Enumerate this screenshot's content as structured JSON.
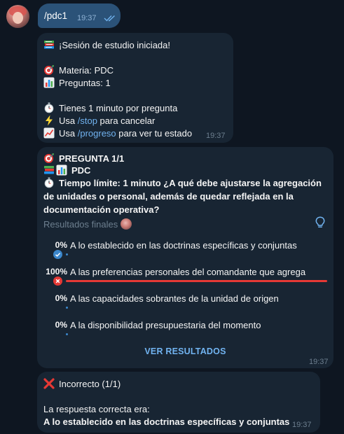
{
  "outgoing": {
    "command": "/pdc1",
    "time": "19:37"
  },
  "session_msg": {
    "title": "¡Sesión de estudio iniciada!",
    "subject": "Materia: PDC",
    "questions": "Preguntas: 1",
    "time_per_question": "Tienes 1 minuto por pregunta",
    "stop_pre": "Usa ",
    "stop_cmd": "/stop",
    "stop_post": " para cancelar",
    "progress_pre": "Usa ",
    "progress_cmd": "/progreso",
    "progress_post": " para ver tu estado",
    "time": "19:37",
    "icons": [
      "books-emoji",
      "target-emoji",
      "bar-chart-emoji",
      "stopwatch-emoji",
      "lightning-emoji",
      "chart-increasing-emoji"
    ]
  },
  "poll_msg": {
    "header": "PREGUNTA 1/1",
    "subject": "PDC",
    "question": "Tiempo límite: 1 minuto  ¿A qué debe ajustarse la agregación de unidades o personal, además de quedar reflejada en la documentación operativa?",
    "status": "Resultados finales",
    "options": [
      {
        "percent_text": "0%",
        "label": "A lo establecido en las doctrinas específicas y conjuntas",
        "percent": 0,
        "correct": true
      },
      {
        "percent_text": "100%",
        "label": "A las preferencias personales del comandante que agrega",
        "percent": 100,
        "chosen_wrong": true
      },
      {
        "percent_text": "0%",
        "label": "A las capacidades sobrantes de la unidad de origen",
        "percent": 0
      },
      {
        "percent_text": "0%",
        "label": "A la disponibilidad presupuestaria del momento",
        "percent": 0
      }
    ],
    "results_button": "VER RESULTADOS",
    "time": "19:37",
    "colors": {
      "correct": "#3b87cc",
      "wrong": "#e53935"
    }
  },
  "result_msg": {
    "verdict": "Incorrecto (1/1)",
    "answer_intro": "La respuesta correcta era:",
    "answer": "A lo establecido en las doctrinas específicas y conjuntas",
    "time": "19:37"
  }
}
